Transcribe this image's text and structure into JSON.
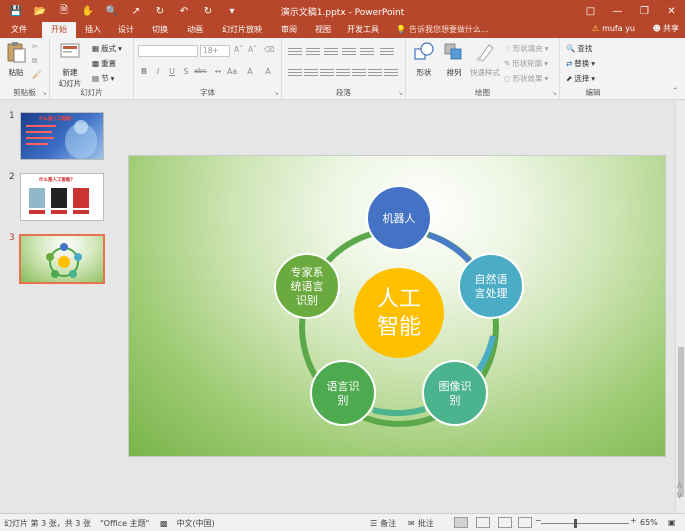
{
  "titlebar": {
    "title": "演示文稿1.pptx - PowerPoint"
  },
  "tabs": [
    {
      "label": "文件"
    },
    {
      "label": "开始"
    },
    {
      "label": "插入"
    },
    {
      "label": "设计"
    },
    {
      "label": "切换"
    },
    {
      "label": "动画"
    },
    {
      "label": "幻灯片放映"
    },
    {
      "label": "审阅"
    },
    {
      "label": "视图"
    },
    {
      "label": "开发工具"
    }
  ],
  "active_tab": "开始",
  "tell_me": "告诉我您想要做什么...",
  "user": {
    "warning": "⚠",
    "name": "mufa yu"
  },
  "share": "共享",
  "ribbon": {
    "clipboard": {
      "paste": "粘贴",
      "label": "剪贴板"
    },
    "slides": {
      "new_slide": "新建",
      "new_slide2": "幻灯片",
      "layout": "版式",
      "reset": "重置",
      "section": "节",
      "label": "幻灯片"
    },
    "font": {
      "size": "18+",
      "label": "字体"
    },
    "paragraph": {
      "label": "段落"
    },
    "drawing": {
      "shape": "形状",
      "arrange": "排列",
      "quick_styles": "快速样式",
      "fill": "形状填充",
      "outline": "形状轮廓",
      "effects": "形状效果",
      "label": "绘图"
    },
    "editing": {
      "find": "查找",
      "replace": "替换",
      "select": "选择",
      "label": "编辑"
    }
  },
  "thumbnails": [
    {
      "num": "1",
      "heading": "什么是人工智能？"
    },
    {
      "num": "2",
      "heading": "什么是人工智能？"
    },
    {
      "num": "3"
    }
  ],
  "slide": {
    "center": {
      "line1": "人工",
      "line2": "智能",
      "color": "#ffc000"
    },
    "nodes": [
      {
        "lines": [
          "机器人"
        ],
        "color": "#4472c4"
      },
      {
        "lines": [
          "自然语",
          "言处理"
        ],
        "color": "#4bacc6"
      },
      {
        "lines": [
          "图像识",
          "别"
        ],
        "color": "#4bb38e"
      },
      {
        "lines": [
          "语言识",
          "别"
        ],
        "color": "#4eaa4e"
      },
      {
        "lines": [
          "专家系",
          "统语言",
          "识别"
        ],
        "color": "#6aaa3e"
      }
    ]
  },
  "statusbar": {
    "slide_info": "幻灯片 第 3 张，共 3 张",
    "theme": "\"Office 主题\"",
    "language": "中文(中国)",
    "notes": "备注",
    "comments": "批注",
    "zoom": "65%"
  }
}
